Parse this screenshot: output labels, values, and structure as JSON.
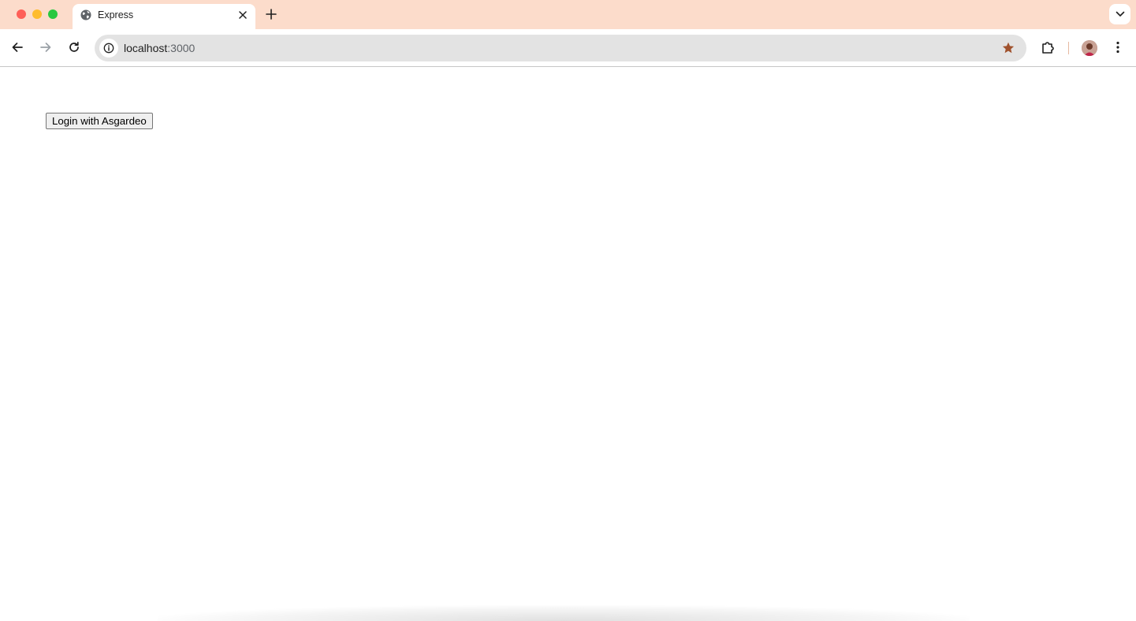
{
  "browser": {
    "tab": {
      "title": "Express",
      "favicon": "globe-icon"
    },
    "address_bar": {
      "host": "localhost",
      "port": ":3000"
    },
    "bookmark_star_color": "#a0522d",
    "tabstrip_color": "#fcdccb"
  },
  "page": {
    "login_button_label": "Login with Asgardeo"
  }
}
